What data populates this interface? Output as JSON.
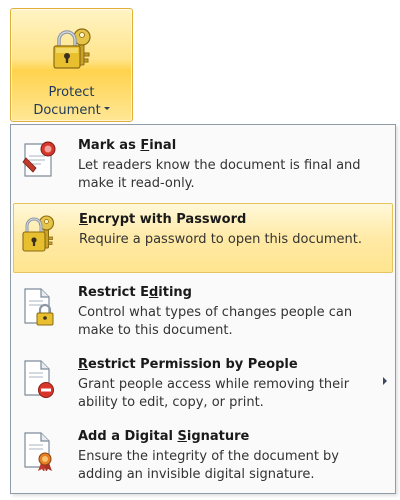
{
  "ribbon_button": {
    "line1": "Protect",
    "line2": "Document",
    "icon": "lock-with-key-icon"
  },
  "menu": {
    "items": [
      {
        "title_pre": "Mark as ",
        "title_accel": "F",
        "title_post": "inal",
        "desc": "Let readers know the document is final and make it read-only.",
        "icon": "document-ribbon-seal-icon",
        "highlighted": false,
        "has_submenu": false
      },
      {
        "title_pre": "",
        "title_accel": "E",
        "title_post": "ncrypt with Password",
        "desc": "Require a password to open this document.",
        "icon": "lock-with-key-icon",
        "highlighted": true,
        "has_submenu": false
      },
      {
        "title_pre": "Restrict E",
        "title_accel": "d",
        "title_post": "iting",
        "desc": "Control what types of changes people can make to this document.",
        "icon": "document-padlock-icon",
        "highlighted": false,
        "has_submenu": false
      },
      {
        "title_pre": "",
        "title_accel": "R",
        "title_post": "estrict Permission by People",
        "desc": "Grant people access while removing their ability to edit, copy, or print.",
        "icon": "document-no-entry-icon",
        "highlighted": false,
        "has_submenu": true
      },
      {
        "title_pre": "Add a Digital ",
        "title_accel": "S",
        "title_post": "ignature",
        "desc": "Ensure the integrity of the document by adding an invisible digital signature.",
        "icon": "document-award-ribbon-icon",
        "highlighted": false,
        "has_submenu": false
      }
    ]
  },
  "colors": {
    "highlight": "#ffe58f",
    "ribbon_border": "#e0b03a",
    "menu_border": "#8f9caa"
  }
}
